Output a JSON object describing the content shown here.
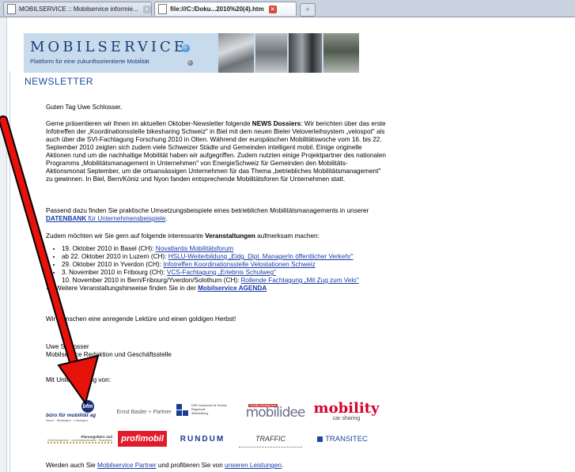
{
  "browser": {
    "tabs": [
      {
        "label": "MOBILSERVICE :: Mobilservice informie...",
        "active": false
      },
      {
        "label": "file:///C:/Doku...2010%20(4).htm",
        "active": true
      }
    ],
    "new_tab_symbol": "+"
  },
  "banner": {
    "logo": "MOBILSERVICE",
    "tagline": "Plattform für eine zukunftsorientierte Mobilität"
  },
  "newsletter": {
    "heading": "NEWSLETTER",
    "greeting": "Guten Tag Uwe Schlosser,",
    "intro_before_bold": "Gerne präsentieren wir Ihnen im aktuellen Oktober-Newsletter folgende ",
    "intro_bold": "NEWS Dossiers",
    "intro_after_bold": ": Wir berichten über das erste Infotreffen der „Koordinationsstelle bikesharing Schweiz\" in Biel mit dem neuen Bieler Veloverleihsystem „velospot\" als auch über die SVI-Fachtagung Forschung 2010 in Olten. Während der europäischen Mobilitätswoche vom 16. bis 22. September 2010 zeigten sich zudem viele Schweizer Städte und Gemeinden intelligent mobil. Einige originelle Aktionen rund um die nachhaltige Mobilität haben wir aufgegriffen. Zudem nutzten einige Projektpartner des nationalen Programms „Mobilitätsmanagement in Unternehmen\" von EnergieSchweiz für Gemeinden den Mobilitäts-Aktionsmonat September, um die ortsansässigen Unternehmen für das Thema „betriebliches Mobilitätsmanagement\" zu gewinnen. In Biel, Bern/Köniz und Nyon fanden entsprechende Mobilitätsforen für Unternehmen statt.",
    "datenbank_before": "Passend dazu finden Sie praktische Umsetzungsbeispiele eines betrieblichen Mobilitätsmanagements in unserer ",
    "datenbank_link_bold": "DATENBANK",
    "datenbank_link_rest": " für Unternehmensbeispiele",
    "datenbank_after": ".",
    "events_before": "Zudem möchten wir Sie gern auf folgende interessante ",
    "events_bold": "Veranstaltungen",
    "events_after": " aufmerksam machen:",
    "events": [
      {
        "text": "19. Oktober 2010 in Basel (CH): ",
        "link": "Novatlantis Mobilitätsforum"
      },
      {
        "text": "ab 22. Oktober 2010 in Luzern (CH): ",
        "link": "HSLU-Weiterbildung „Eidg. Dipl. ManagerIn öffentlicher Verkehr\""
      },
      {
        "text": "29. Oktober 2010 in Yverdon (CH): ",
        "link": "Infotreffen Koordinationsstelle Velostationen Schweiz"
      },
      {
        "text": "3. November 2010 in Fribourg (CH): ",
        "link": "VCS-Fachtagung „Erlebnis Schulweg\""
      },
      {
        "text": "10. November 2010 in Bern/Fribourg/Yverdon/Solothurn (CH): ",
        "link": "Rollende Fachtagung „Mit Zug zum Velo\""
      }
    ],
    "more_events_before": "Weitere Veranstaltungshinweise finden Sie in der ",
    "more_events_link": "Mobilservice AGENDA",
    "closing": "Wir wünschen eine anregende Lektüre und einen goldigen Herbst!",
    "sign_name": "Uwe Schlosser",
    "sign_role": "Mobilservice Redaktion und Geschäftsstelle",
    "support_label": "Mit Unterstützung von:",
    "partner_before": "Werden auch Sie ",
    "partner_link": "Mobilservice Partner",
    "partner_middle": " und profitieren Sie von ",
    "partner_link2": "unseren Leistungen",
    "partner_after": "."
  },
  "sponsors": [
    {
      "name": "büro für mobilität ag",
      "sub": "Ideen · Strategien · Lösungen",
      "badge": "bfm"
    },
    {
      "name": "Ernst Basler + Partner"
    },
    {
      "name": "HSR Hochschule für Technik Rapperswil",
      "sub": "Weiterbildung"
    },
    {
      "name": "mobilidee",
      "badge": "Mobility Management"
    },
    {
      "name": "mobility",
      "sub": "car sharing"
    },
    {
      "name": "Planungsbüro Jud",
      "sub": "Verkehrsingenieure · Umweltwissenschafter · Raumplaner"
    },
    {
      "name": "profimobil"
    },
    {
      "name": "RUNDUM"
    },
    {
      "name": "TRAFFIC"
    },
    {
      "name": "TRANSITEC"
    }
  ],
  "colors": {
    "link": "#1a3ba8",
    "heading": "#1a4a9c",
    "banner_bg": "#c7dbed",
    "annotation_arrow": "#e8120c"
  }
}
